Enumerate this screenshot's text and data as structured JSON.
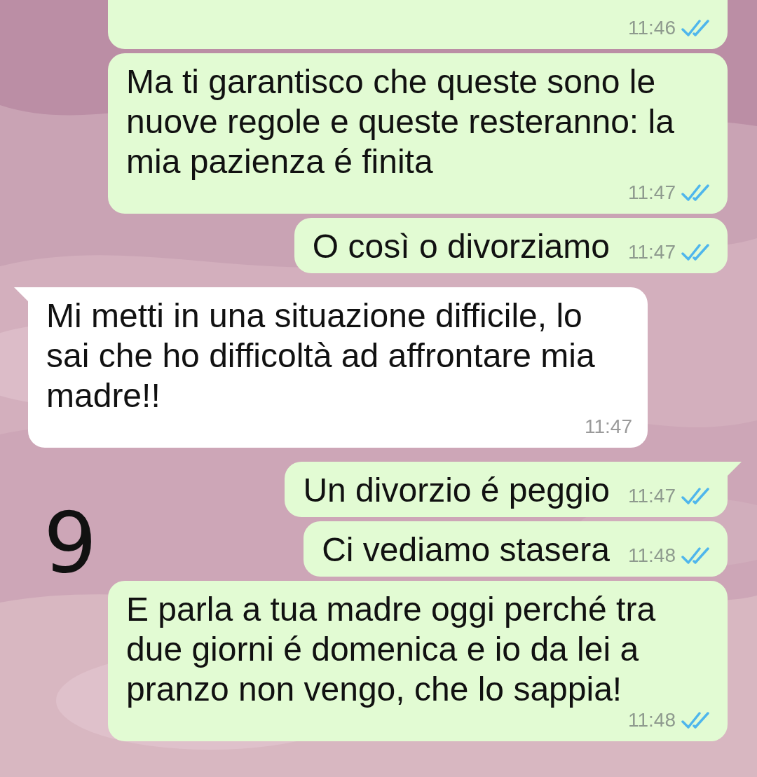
{
  "messages": [
    {
      "kind": "out",
      "tail": false,
      "cut": true,
      "time": "11:46",
      "read": true
    },
    {
      "kind": "out",
      "tail": false,
      "text": "Ma ti garantisco che queste sono le nuove regole e queste resteranno: la mia pazienza é finita",
      "time": "11:47",
      "read": true
    },
    {
      "kind": "out",
      "tail": false,
      "text": "O così o divorziamo",
      "time": "11:47",
      "read": true
    },
    {
      "kind": "in",
      "tail": true,
      "text": "Mi metti in una situazione difficile, lo sai che ho difficoltà ad affrontare mia madre!!",
      "time": "11:47"
    },
    {
      "kind": "out",
      "tail": true,
      "text": "Un divorzio é peggio",
      "time": "11:47",
      "read": true
    },
    {
      "kind": "out",
      "tail": false,
      "text": "Ci vediamo stasera",
      "time": "11:48",
      "read": true
    },
    {
      "kind": "out",
      "tail": false,
      "text": "E parla a tua madre oggi perché tra due giorni é domenica e io da lei a pranzo non vengo, che lo sappia!",
      "time": "11:48",
      "read": true
    }
  ],
  "annotation": "9"
}
